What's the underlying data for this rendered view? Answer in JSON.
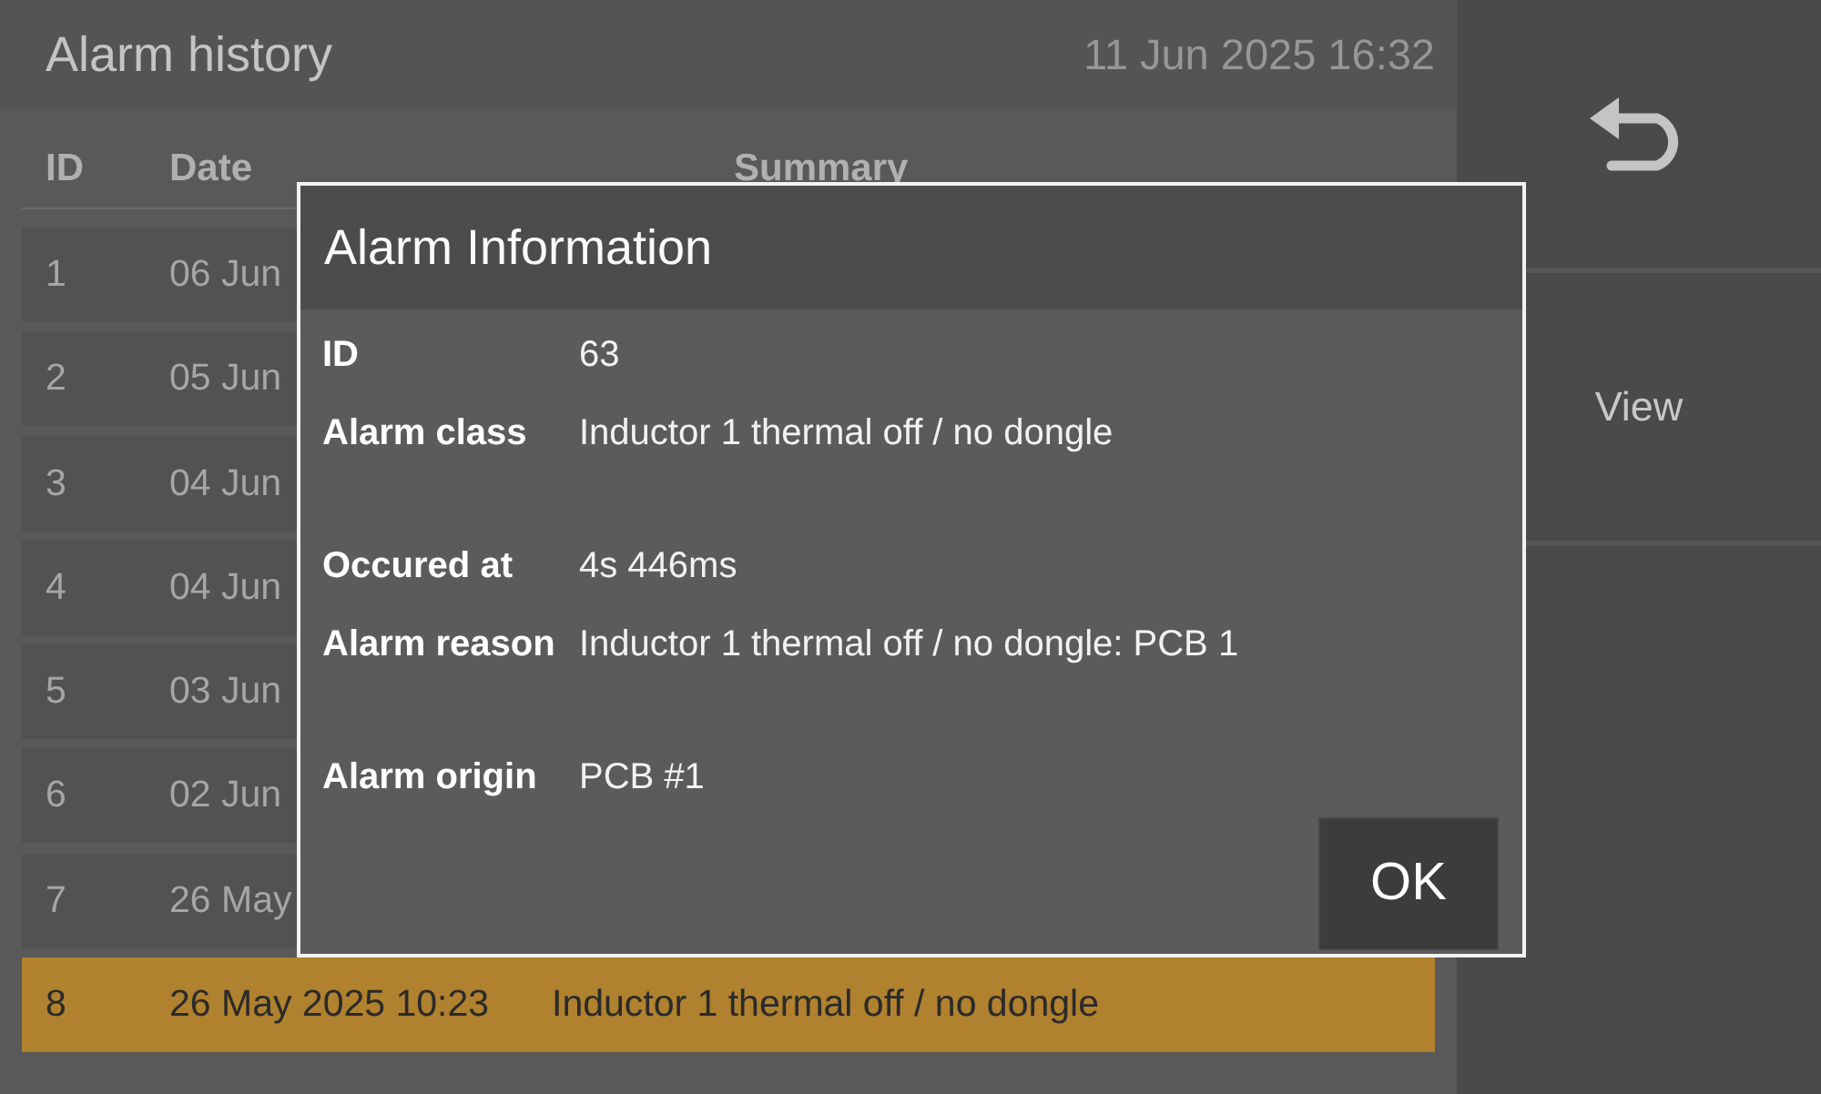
{
  "header": {
    "title": "Alarm history",
    "datetime": "11 Jun 2025 16:32"
  },
  "table": {
    "columns": [
      "ID",
      "Date",
      "Summary"
    ],
    "rows": [
      {
        "id": "1",
        "date": "06 Jun",
        "selected": false
      },
      {
        "id": "2",
        "date": "05 Jun",
        "selected": false
      },
      {
        "id": "3",
        "date": "04 Jun",
        "selected": false
      },
      {
        "id": "4",
        "date": "04 Jun",
        "selected": false
      },
      {
        "id": "5",
        "date": "03 Jun",
        "selected": false
      },
      {
        "id": "6",
        "date": "02 Jun",
        "selected": false
      },
      {
        "id": "7",
        "date": "26 May",
        "selected": false
      },
      {
        "id": "8",
        "date": "26 May 2025 10:23",
        "summary": "Inductor 1 thermal off / no dongle",
        "selected": true
      }
    ]
  },
  "side_panel": {
    "buttons": [
      {
        "kind": "icon"
      },
      {
        "kind": "text",
        "label": "View"
      }
    ]
  },
  "dialog": {
    "title": "Alarm Information",
    "fields": [
      {
        "kind": "field",
        "label": "ID",
        "value": "63"
      },
      {
        "kind": "field",
        "label": "Alarm class",
        "value": "Inductor 1 thermal off / no dongle"
      },
      {
        "kind": "spacer"
      },
      {
        "kind": "field",
        "label": "Occured at",
        "value": "4s 446ms"
      },
      {
        "kind": "field",
        "label": "Alarm reason",
        "value": "Inductor 1 thermal off / no dongle: PCB 1"
      },
      {
        "kind": "spacer"
      },
      {
        "kind": "field",
        "label": "Alarm origin",
        "value": "PCB #1"
      }
    ],
    "button": "OK"
  }
}
